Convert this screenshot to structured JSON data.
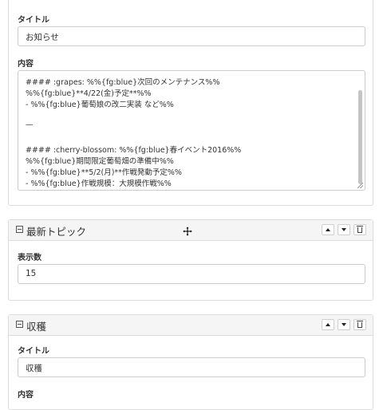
{
  "panel1": {
    "title_label": "タイトル",
    "title_value": "お知らせ",
    "content_label": "内容",
    "content_lines": [
      "#### :grapes: %%{fg:blue}次回のメンテナンス%%",
      "%%{fg:blue}**4/22(金)予定**%%",
      "- %%{fg:blue}葡萄娘の改二実装 など%%",
      "",
      "—",
      "",
      "#### :cherry-blossom: %%{fg:blue}春イベント2016%%",
      "%%{fg:blue}期間限定葡萄畑の準備中%%",
      "- %%{fg:blue}**5/2(月)**作戦発動予定%%",
      "- %%{fg:blue}作戦規模：大規模作戦%%"
    ]
  },
  "panel2": {
    "title": "最新トピック",
    "count_label": "表示数",
    "count_value": "15"
  },
  "panel3": {
    "title": "収穫",
    "title_label": "タイトル",
    "title_value": "収穫",
    "content_label": "内容"
  }
}
